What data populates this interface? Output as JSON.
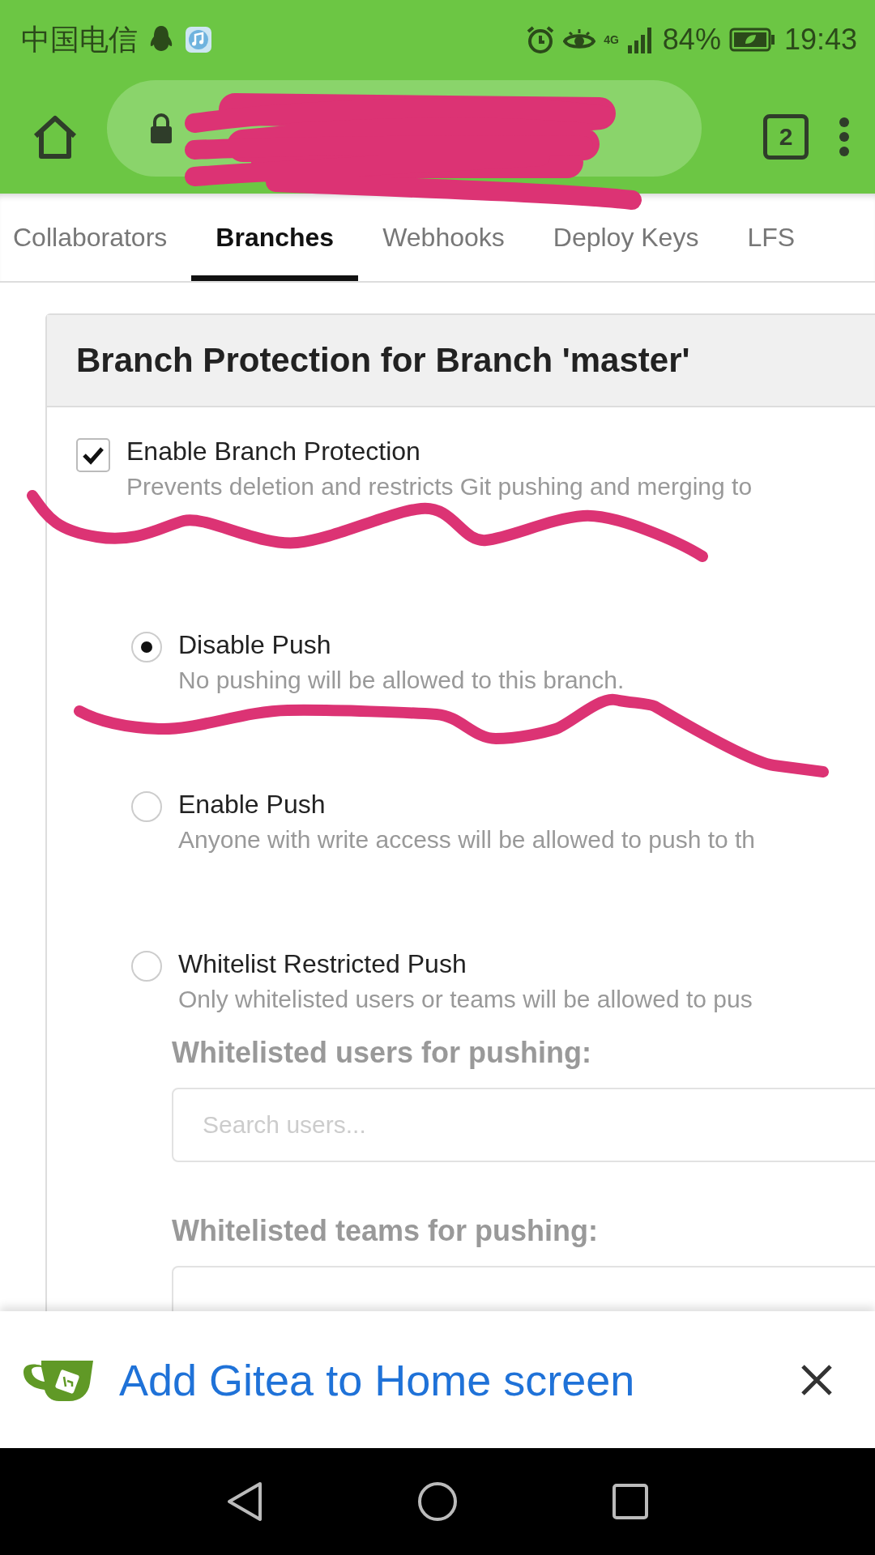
{
  "status_bar": {
    "carrier": "中国电信",
    "network": "4G",
    "battery": "84%",
    "time": "19:43"
  },
  "browser_toolbar": {
    "tab_count": "2"
  },
  "tabs": [
    {
      "label": "Collaborators",
      "selected": false
    },
    {
      "label": "Branches",
      "selected": true
    },
    {
      "label": "Webhooks",
      "selected": false
    },
    {
      "label": "Deploy Keys",
      "selected": false
    },
    {
      "label": "LFS",
      "selected": false
    }
  ],
  "card": {
    "title": "Branch Protection for Branch 'master'",
    "protection": {
      "label": "Enable Branch Protection",
      "description": "Prevents deletion and restricts Git pushing and merging to",
      "checked": true
    },
    "push_options": [
      {
        "label": "Disable Push",
        "description": "No pushing will be allowed to this branch.",
        "selected": true
      },
      {
        "label": "Enable Push",
        "description": "Anyone with write access will be allowed to push to th",
        "selected": false
      },
      {
        "label": "Whitelist Restricted Push",
        "description": "Only whitelisted users or teams will be allowed to pus",
        "selected": false
      }
    ],
    "whitelist_fields": [
      {
        "label": "Whitelisted users for pushing:",
        "placeholder": "Search users..."
      },
      {
        "label": "Whitelisted teams for pushing:"
      }
    ]
  },
  "install_banner": {
    "text": "Add Gitea to Home screen"
  }
}
